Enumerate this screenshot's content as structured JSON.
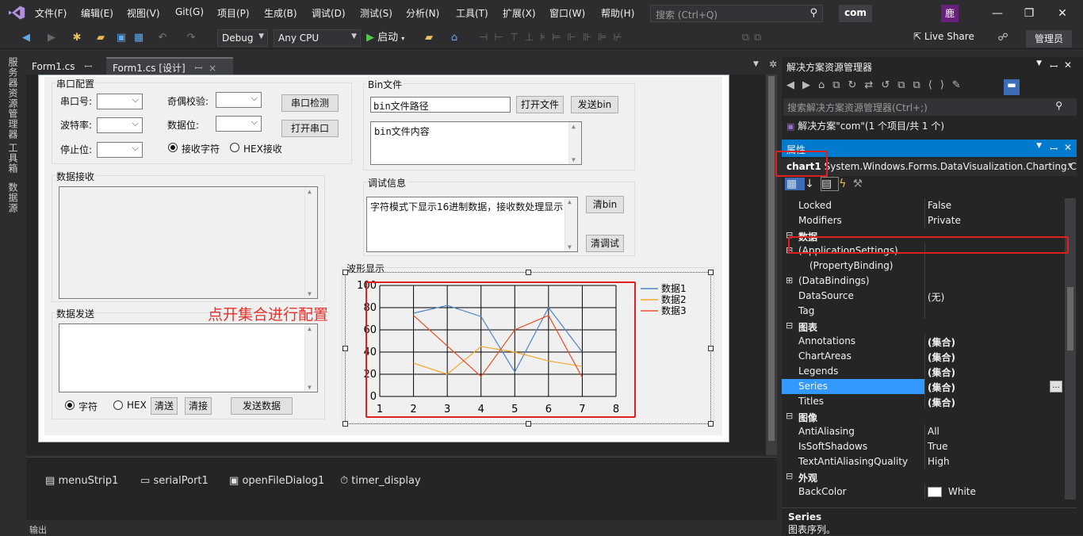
{
  "menubar": {
    "items": [
      "文件(F)",
      "编辑(E)",
      "视图(V)",
      "Git(G)",
      "项目(P)",
      "生成(B)",
      "调试(D)",
      "测试(S)",
      "分析(N)",
      "工具(T)",
      "扩展(X)",
      "窗口(W)",
      "帮助(H)"
    ],
    "search_placeholder": "搜索 (Ctrl+Q)",
    "solution_name": "com",
    "avatar": "鹿"
  },
  "toolbar": {
    "config": "Debug",
    "platform": "Any CPU",
    "start": "启动",
    "live_share": "Live Share",
    "admin": "管理员"
  },
  "left_rail": [
    "服务器资源管理器",
    "工具箱",
    "数据源"
  ],
  "doc_tabs": [
    {
      "label": "Form1.cs",
      "pin": "ꟷ"
    },
    {
      "label": "Form1.cs [设计]",
      "pin": "ꟷ",
      "close": "×"
    }
  ],
  "form": {
    "serial_group": "串口配置",
    "port_label": "串口号:",
    "baud_label": "波特率:",
    "stop_label": "停止位:",
    "parity_label": "奇偶校验:",
    "databits_label": "数据位:",
    "detect_btn": "串口检测",
    "open_btn": "打开串口",
    "recv_char": "接收字符",
    "recv_hex": "HEX接收",
    "bin_group": "Bin文件",
    "bin_path": "bin文件路径",
    "open_file_btn": "打开文件",
    "send_bin_btn": "发送bin",
    "bin_content": "bin文件内容",
    "recv_group": "数据接收",
    "debug_group": "调试信息",
    "debug_text": "字符模式下显示16进制数据，接收数处理显示",
    "clear_bin_btn": "清bin",
    "clear_debug_btn": "清调试",
    "send_group": "数据发送",
    "send_char": "字符",
    "send_hex": "HEX",
    "clear_send_btn": "清送",
    "clear_recv_btn": "清接",
    "send_data_btn": "发送数据",
    "wave_group": "波形显示"
  },
  "annotation": "点开集合进行配置",
  "chart_data": {
    "type": "line",
    "x": [
      1,
      2,
      3,
      4,
      5,
      6,
      7,
      8
    ],
    "xlim": [
      1,
      8
    ],
    "ylim": [
      0,
      100
    ],
    "xticks": [
      "1",
      "2",
      "3",
      "4",
      "5",
      "6",
      "7",
      "8"
    ],
    "yticks": [
      "0",
      "20",
      "40",
      "60",
      "80",
      "100"
    ],
    "grid": true,
    "legend_position": "right",
    "series": [
      {
        "name": "数据1",
        "color": "#4a86c8",
        "x": [
          2,
          3,
          4,
          5,
          6,
          7
        ],
        "values": [
          75,
          82,
          72,
          22,
          80,
          40
        ]
      },
      {
        "name": "数据2",
        "color": "#f0a830",
        "x": [
          2,
          3,
          4,
          5,
          6,
          7
        ],
        "values": [
          30,
          20,
          45,
          40,
          32,
          27
        ]
      },
      {
        "name": "数据3",
        "color": "#e8502a",
        "x": [
          2,
          4,
          5,
          6,
          7
        ],
        "values": [
          73,
          18,
          60,
          73,
          17
        ]
      }
    ]
  },
  "tray": [
    "menuStrip1",
    "serialPort1",
    "openFileDialog1",
    "timer_display"
  ],
  "output_tab": "输出",
  "solution_explorer": {
    "title": "解决方案资源管理器",
    "search": "搜索解决方案资源管理器(Ctrl+;)",
    "solution": "解决方案\"com\"(1 个项目/共 1 个)"
  },
  "properties": {
    "title": "属性",
    "object": "chart1",
    "type": "System.Windows.Forms.DataVisualization.Charting.Ch",
    "rows": [
      {
        "name": "Locked",
        "value": "False",
        "kind": "prop"
      },
      {
        "name": "Modifiers",
        "value": "Private",
        "kind": "prop"
      },
      {
        "name": "数据",
        "value": "",
        "kind": "cat",
        "toggle": "⊟"
      },
      {
        "name": "(ApplicationSettings)",
        "value": "",
        "kind": "prop",
        "toggle": "⊟"
      },
      {
        "name": "(PropertyBinding)",
        "value": "",
        "kind": "sub"
      },
      {
        "name": "(DataBindings)",
        "value": "",
        "kind": "prop",
        "toggle": "⊞"
      },
      {
        "name": "DataSource",
        "value": "(无)",
        "kind": "prop"
      },
      {
        "name": "Tag",
        "value": "",
        "kind": "prop"
      },
      {
        "name": "图表",
        "value": "",
        "kind": "cat",
        "toggle": "⊟"
      },
      {
        "name": "Annotations",
        "value": "(集合)",
        "kind": "prop",
        "bold": true
      },
      {
        "name": "ChartAreas",
        "value": "(集合)",
        "kind": "prop",
        "bold": true
      },
      {
        "name": "Legends",
        "value": "(集合)",
        "kind": "prop",
        "bold": true
      },
      {
        "name": "Series",
        "value": "(集合)",
        "kind": "selected",
        "bold": true
      },
      {
        "name": "Titles",
        "value": "(集合)",
        "kind": "prop",
        "bold": true
      },
      {
        "name": "图像",
        "value": "",
        "kind": "cat",
        "toggle": "⊟"
      },
      {
        "name": "AntiAliasing",
        "value": "All",
        "kind": "prop"
      },
      {
        "name": "IsSoftShadows",
        "value": "True",
        "kind": "prop"
      },
      {
        "name": "TextAntiAliasingQuality",
        "value": "High",
        "kind": "prop"
      },
      {
        "name": "外观",
        "value": "",
        "kind": "cat",
        "toggle": "⊟"
      },
      {
        "name": "BackColor",
        "value": "White",
        "kind": "color"
      }
    ],
    "desc_title": "Series",
    "desc_text": "图表序列。",
    "ellipsis": "..."
  }
}
